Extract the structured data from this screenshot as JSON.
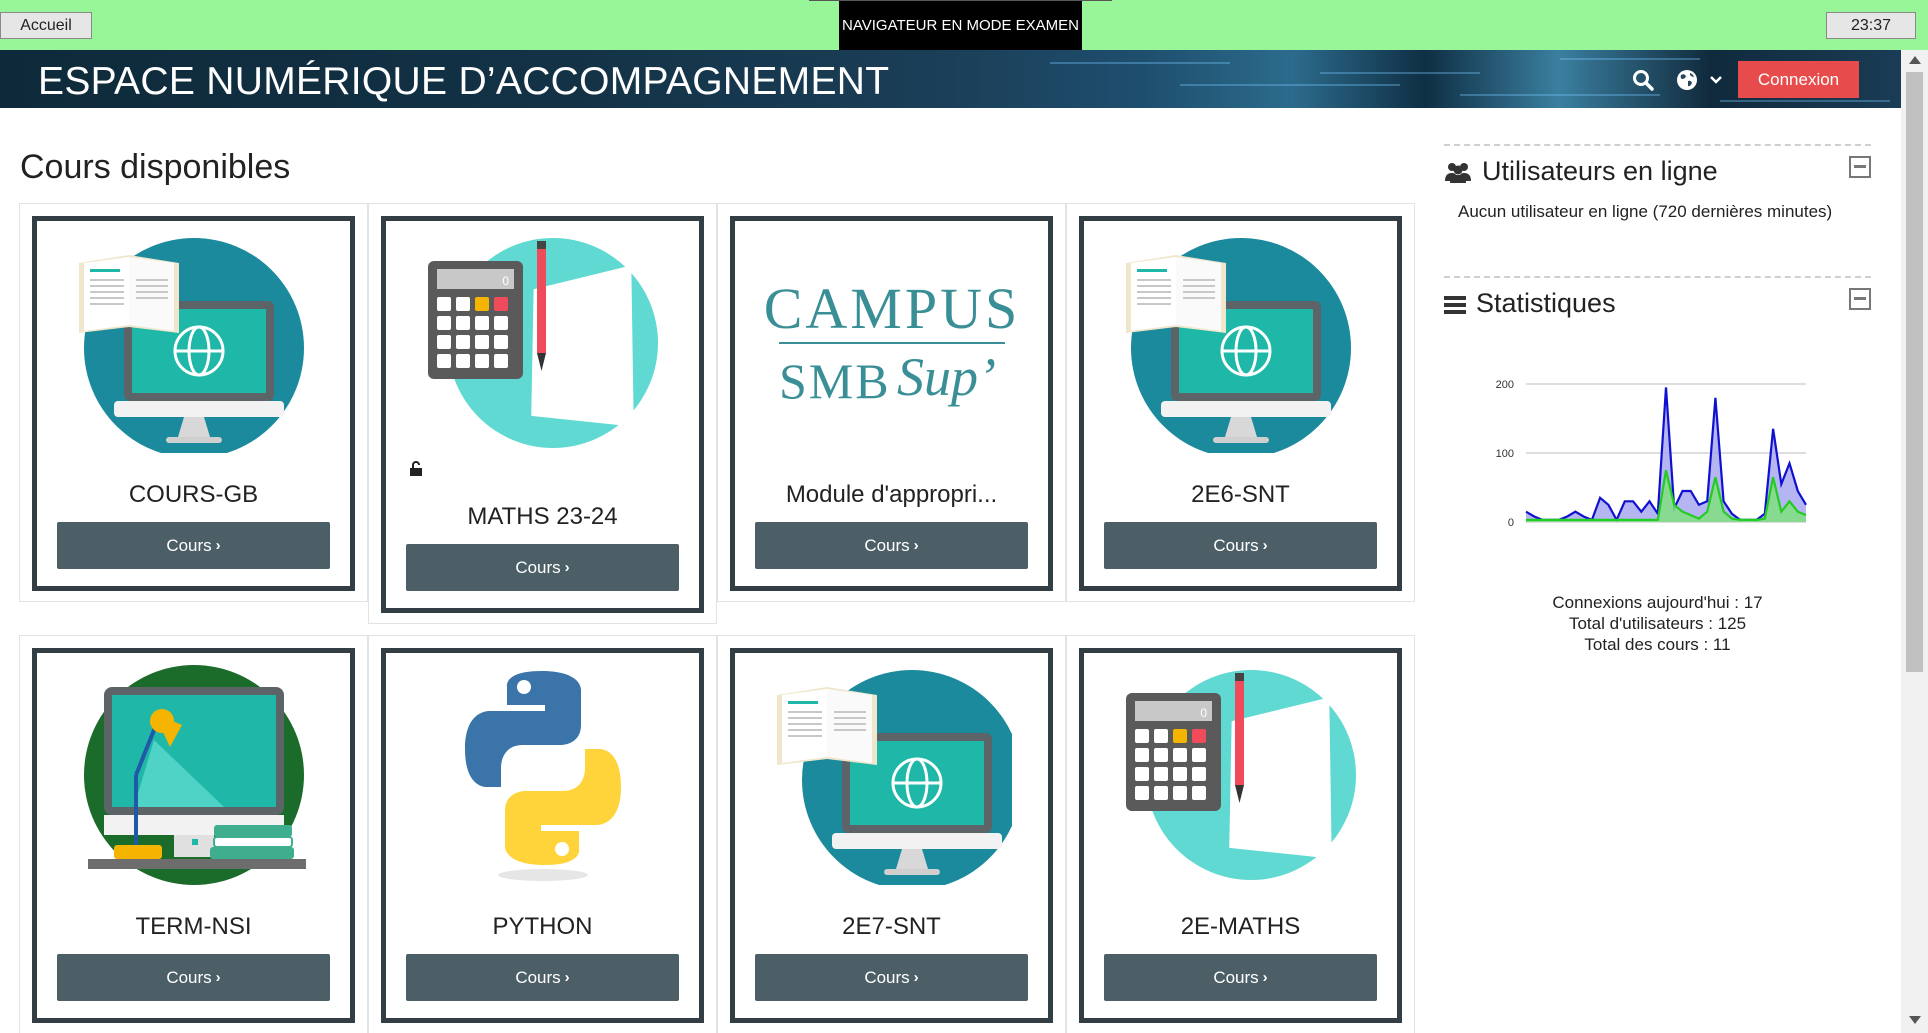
{
  "topbar": {
    "home_label": "Accueil",
    "exam_mode_label": "NAVIGATEUR EN MODE EXAMEN",
    "clock": "23:37",
    "bg_color": "#98f598"
  },
  "header": {
    "site_title": "ESPACE NUMÉRIQUE D’ACCOMPAGNEMENT",
    "login_label": "Connexion",
    "login_color": "#e84b4b",
    "icons": [
      "search-icon",
      "globe-icon",
      "chevron-down-icon"
    ]
  },
  "main": {
    "title": "Cours disponibles",
    "courses": [
      {
        "name": "COURS-GB",
        "button": "Cours",
        "image": "computer-book-globe"
      },
      {
        "name": "MATHS 23-24",
        "button": "Cours",
        "image": "calculator-pencil",
        "lock_icon": "unlock-icon"
      },
      {
        "name": "Module d'appropri...",
        "button": "Cours",
        "image_logo_text": "CAMPUS SMB Sup'"
      },
      {
        "name": "2E6-SNT",
        "button": "Cours",
        "image": "computer-book-globe"
      },
      {
        "name": "TERM-NSI",
        "button": "Cours",
        "image": "computer-desk-lamp"
      },
      {
        "name": "PYTHON",
        "button": "Cours",
        "image": "python-logo"
      },
      {
        "name": "2E7-SNT",
        "button": "Cours",
        "image": "computer-book-globe"
      },
      {
        "name": "2E-MATHS",
        "button": "Cours",
        "image": "calculator-pencil"
      }
    ],
    "button_color": "#4d5f66"
  },
  "sidebar": {
    "online": {
      "title": "Utilisateurs en ligne",
      "icon": "users-icon",
      "text": "Aucun utilisateur en ligne (720 dernières minutes)"
    },
    "stats": {
      "title": "Statistiques",
      "icon": "bars-icon",
      "lines": [
        "Connexions aujourd'hui : 17",
        "Total d'utilisateurs : 125",
        "Total des cours : 11"
      ]
    }
  },
  "chart_data": {
    "type": "area",
    "yticks": [
      0,
      100,
      200
    ],
    "ylim": [
      0,
      200
    ],
    "grid": true,
    "series": [
      {
        "color": "#1010d0",
        "fill": "#a8a8f0",
        "values": [
          15,
          8,
          3,
          3,
          3,
          8,
          15,
          8,
          3,
          35,
          25,
          3,
          30,
          30,
          15,
          30,
          12,
          195,
          20,
          45,
          45,
          25,
          30,
          180,
          30,
          12,
          3,
          3,
          3,
          12,
          135,
          55,
          85,
          45,
          25
        ]
      },
      {
        "color": "#22cc22",
        "fill": "#7fe07f",
        "values": [
          3,
          3,
          3,
          3,
          3,
          3,
          3,
          3,
          3,
          3,
          3,
          3,
          3,
          3,
          3,
          3,
          3,
          75,
          25,
          15,
          10,
          5,
          15,
          65,
          15,
          5,
          3,
          3,
          3,
          5,
          65,
          15,
          30,
          15,
          10
        ]
      }
    ]
  }
}
